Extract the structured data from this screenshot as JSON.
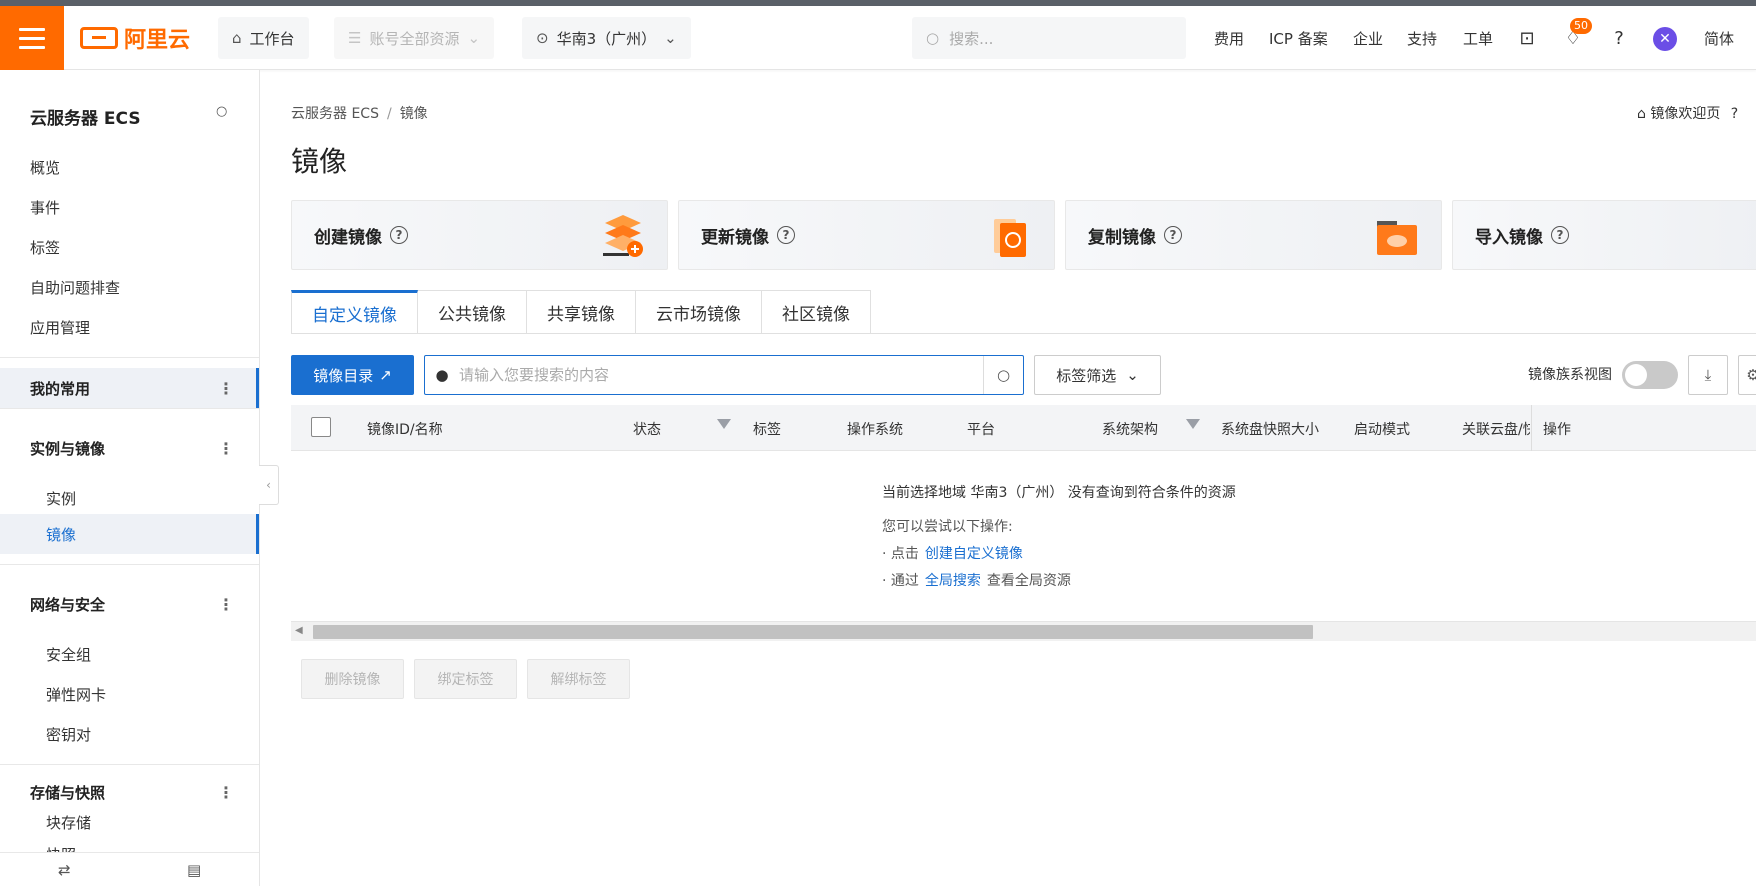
{
  "header": {
    "logo_text": "阿里云",
    "workbench": "工作台",
    "account_scope": "账号全部资源",
    "region": "华南3（广州）",
    "search_placeholder": "搜索...",
    "nav": [
      "费用",
      "ICP 备案",
      "企业",
      "支持",
      "工单"
    ],
    "notification_count": "50",
    "language": "简体"
  },
  "sidebar": {
    "title": "云服务器 ECS",
    "top_items": [
      "概览",
      "事件",
      "标签",
      "自助问题排查",
      "应用管理"
    ],
    "favorites": "我的常用",
    "groups": [
      {
        "label": "实例与镜像",
        "items": [
          "实例",
          "镜像"
        ]
      },
      {
        "label": "网络与安全",
        "items": [
          "安全组",
          "弹性网卡",
          "密钥对"
        ]
      },
      {
        "label": "存储与快照",
        "items": [
          "块存储",
          "快照"
        ]
      }
    ]
  },
  "main": {
    "breadcrumb": [
      "云服务器 ECS",
      "镜像"
    ],
    "welcome_link": "镜像欢迎页",
    "title": "镜像",
    "cards": [
      "创建镜像",
      "更新镜像",
      "复制镜像",
      "导入镜像"
    ],
    "tabs": [
      "自定义镜像",
      "公共镜像",
      "共享镜像",
      "云市场镜像",
      "社区镜像"
    ],
    "catalog_button": "镜像目录",
    "search_placeholder": "请输入您要搜索的内容",
    "tag_filter": "标签筛选",
    "family_view_label": "镜像族系视图",
    "columns": [
      "镜像ID/名称",
      "状态",
      "标签",
      "操作系统",
      "平台",
      "系统架构",
      "系统盘快照大小",
      "启动模式",
      "关联云盘/快照",
      "操作"
    ],
    "empty": {
      "line1": "当前选择地域 华南3（广州） 没有查询到符合条件的资源",
      "line2": "您可以尝试以下操作:",
      "tip1_prefix": "· 点击",
      "tip1_link": "创建自定义镜像",
      "tip2_prefix": "· 通过",
      "tip2_link": "全局搜索",
      "tip2_suffix": "查看全局资源"
    },
    "bulk_buttons": [
      "删除镜像",
      "绑定标签",
      "解绑标签"
    ]
  },
  "colors": {
    "brand": "#ff6a00",
    "primary": "#1a6fd0"
  }
}
